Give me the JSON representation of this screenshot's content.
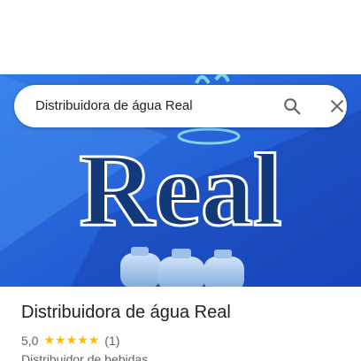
{
  "search": {
    "query": "Distribuidora de água Real"
  },
  "icons": {
    "search": "search-icon",
    "close": "close-icon"
  },
  "hero": {
    "logo_text": "Real",
    "colors": {
      "background": "#1f5fd6",
      "logo_fill": "#123a7a",
      "logo_stroke": "#ffffff"
    }
  },
  "place": {
    "title": "Distribuidora de água Real",
    "rating": "5,0",
    "stars": 5,
    "review_count": "(1)",
    "category": "Distribuidor de bebidas"
  },
  "colors": {
    "star": "#fbbc04",
    "text_primary": "#202124",
    "text_secondary": "#5f6368"
  }
}
